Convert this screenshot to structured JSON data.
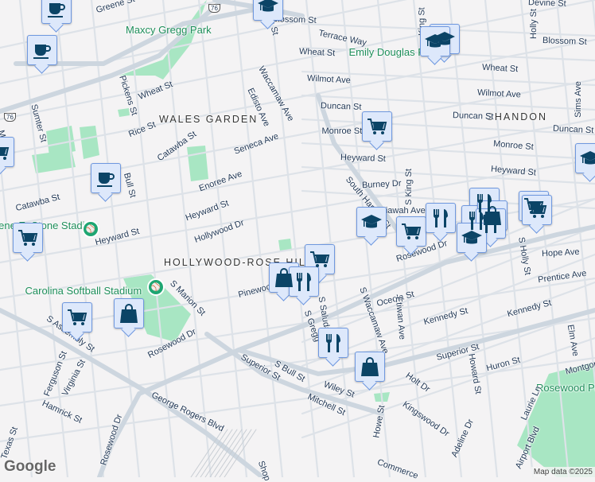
{
  "map": {
    "colors": {
      "background": "#f4f3f4",
      "major_road": "#cdd6df",
      "minor_road": "#dde2e8",
      "park": "#a8e6c3",
      "marker_bg": "#dde8fb",
      "marker_border": "#6f98df",
      "marker_icon": "#0b4466"
    },
    "area_labels": [
      "WALES GARDEN",
      "SHANDON",
      "HOLLYWOOD-ROSE HILL"
    ],
    "park_labels": [
      "Maxcy Gregg Park",
      "Emily Douglas Park",
      "Eugene E. Stone Stadium",
      "Carolina Softball Stadium",
      "Rosewood Park"
    ],
    "street_labels": [
      "Greene St",
      "Blossom St",
      "Devine St",
      "Terrace Way",
      "Wheat St",
      "Wheat St",
      "Blossom St",
      "Holly St",
      "King St",
      "Wilmot Ave",
      "Wilmot Ave",
      "Duncan St",
      "Duncan St",
      "Duncan St",
      "Monroe St",
      "Monroe St",
      "Heyward St",
      "Heyward St",
      "Burney Dr",
      "S King St",
      "Kiawah Ave",
      "South Harden St",
      "Sims Ave",
      "Harden St",
      "Waccamaw Ave",
      "Edisto Ave",
      "Wheat St",
      "Pickens St",
      "Rice St",
      "Catawba St",
      "Seneca Ave",
      "Enoree Ave",
      "Bull St",
      "Catawba St",
      "Heyward St",
      "Hollywood Dr",
      "Heyward St",
      "Sumter St",
      "Main St",
      "Pinewood",
      "S Marion St",
      "Rosewood Dr",
      "Hope Ave",
      "Prentice Ave",
      "S Holly St",
      "Oceola St",
      "Kennedy St",
      "Kennedy St",
      "S Waccamaw Ave",
      "Etiwan Ave",
      "S Saluda",
      "S Gregg",
      "Superior St",
      "Howard St",
      "Huron St",
      "Elm Ave",
      "Montgomery",
      "Holt Dr",
      "Kingswood Dr",
      "Laurie Ln",
      "Airport Blvd",
      "Adeline Dr",
      "Howe St",
      "Wiley St",
      "Mitchell St",
      "Commerce",
      "S Assembly St",
      "Ferguson St",
      "Virginia St",
      "Hamrick St",
      "Rosewood Dr",
      "Rosewood Dr",
      "George Rogers Blvd",
      "Superior St",
      "S Bull St",
      "Texas St",
      "Shop"
    ],
    "route_shields": [
      "76",
      "76"
    ],
    "markers": [
      "cafe",
      "cafe",
      "cafe",
      "grocery",
      "grocery",
      "school",
      "school",
      "school",
      "grocery",
      "school",
      "school",
      "grocery",
      "restaurant",
      "restaurant",
      "restaurant",
      "shopping",
      "restaurant",
      "grocery",
      "grocery",
      "school",
      "grocery",
      "shopping",
      "restaurant",
      "grocery",
      "shopping",
      "restaurant",
      "shopping"
    ],
    "logo": "Google",
    "attribution": "Map data ©2025"
  }
}
